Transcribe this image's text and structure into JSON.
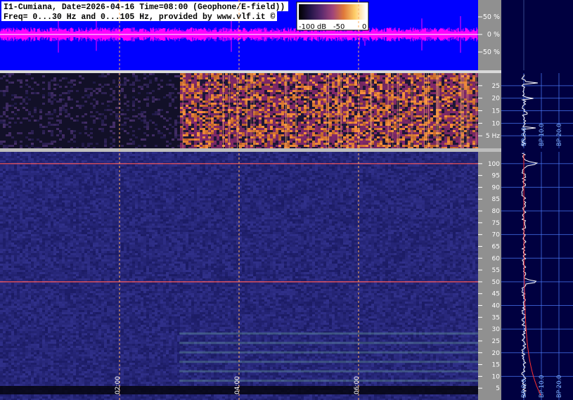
{
  "header": {
    "line1": "I1-Cumiana, Date=2026-04-16 Time=08:00 (Geophone/E-field))",
    "line2": "Freq= 0...30 Hz and 0...105 Hz, provided by www.vlf.it ©"
  },
  "colorbar": {
    "labels": [
      "-100 dB",
      "-50",
      "0"
    ],
    "stops": [
      "#000000",
      "#231446",
      "#5a2a6e",
      "#a0447a",
      "#e07a3a",
      "#ffcf6a",
      "#ffffff"
    ]
  },
  "colors": {
    "waveform_bg": "#0000ff",
    "waveform_trace": "#ff00ff",
    "waveform_center": "#ffffff",
    "spectrogram_bg": "#1a1a46",
    "side_panel_bg": "#000040",
    "grid": "#4d7dff",
    "marker_line": "#ff5a5a",
    "time_line": "#ffb060",
    "spectrum_trace": "#ffffff",
    "noise_floor": "#ff3030"
  },
  "chart_data": [
    {
      "type": "line",
      "name": "waveform",
      "y_ticks": [
        "50 %",
        "0 %",
        "-50 %"
      ],
      "ylim": [
        -100,
        100
      ],
      "envelope_typical_pct": 20
    },
    {
      "type": "heatmap",
      "name": "spectrogram-low",
      "y_ticks": [
        "25",
        "20",
        "15",
        "10",
        "5 Hz"
      ],
      "ylim": [
        0,
        30
      ],
      "time_ticks": [
        "02:00",
        "04:00",
        "06:00"
      ],
      "x_span_hours": [
        0,
        8
      ],
      "bright_from_hour": 3.0
    },
    {
      "type": "heatmap",
      "name": "spectrogram-high",
      "y_ticks": [
        "100",
        "95",
        "90",
        "85",
        "80",
        "75",
        "70",
        "65",
        "60",
        "55",
        "50",
        "45",
        "40",
        "35",
        "30",
        "25",
        "20",
        "15",
        "10",
        "5"
      ],
      "ylim": [
        0,
        105
      ],
      "time_ticks": [
        "02:00",
        "04:00",
        "06:00"
      ],
      "x_span_hours": [
        0,
        8
      ],
      "marker_lines_hz": [
        100,
        50
      ]
    },
    {
      "type": "line",
      "name": "spectrum-profile-low",
      "x_labels": [
        "BP 0.0",
        "BP 10.0",
        "BP 20.0"
      ],
      "ylim": [
        0,
        30
      ],
      "peak_hz": [
        8,
        14,
        20,
        26
      ]
    },
    {
      "type": "line",
      "name": "spectrum-profile-high",
      "x_labels": [
        "BP 0.0",
        "BP 10.0",
        "BP 20.0"
      ],
      "ylim": [
        0,
        105
      ],
      "peak_hz": [
        100,
        50
      ]
    }
  ]
}
